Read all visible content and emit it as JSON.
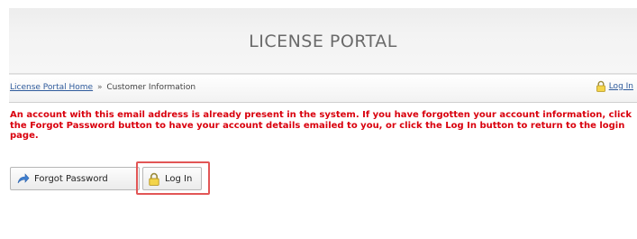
{
  "header": {
    "title": "LICENSE PORTAL"
  },
  "breadcrumb": {
    "home_link": "License Portal Home",
    "separator": "»",
    "current": "Customer Information"
  },
  "header_login_link": "Log In",
  "message": "An account with this email address is already present in the system. If you have forgotten your account information, click the Forgot Password button to have your account details emailed to you, or click the Log In button to return to the login page.",
  "buttons": {
    "forgot_password": "Forgot Password",
    "log_in": "Log In"
  },
  "colors": {
    "message": "#d9000d",
    "link": "#2f5b9c",
    "highlight": "#e25656"
  },
  "icons": [
    "lock-icon",
    "arrow-icon"
  ]
}
